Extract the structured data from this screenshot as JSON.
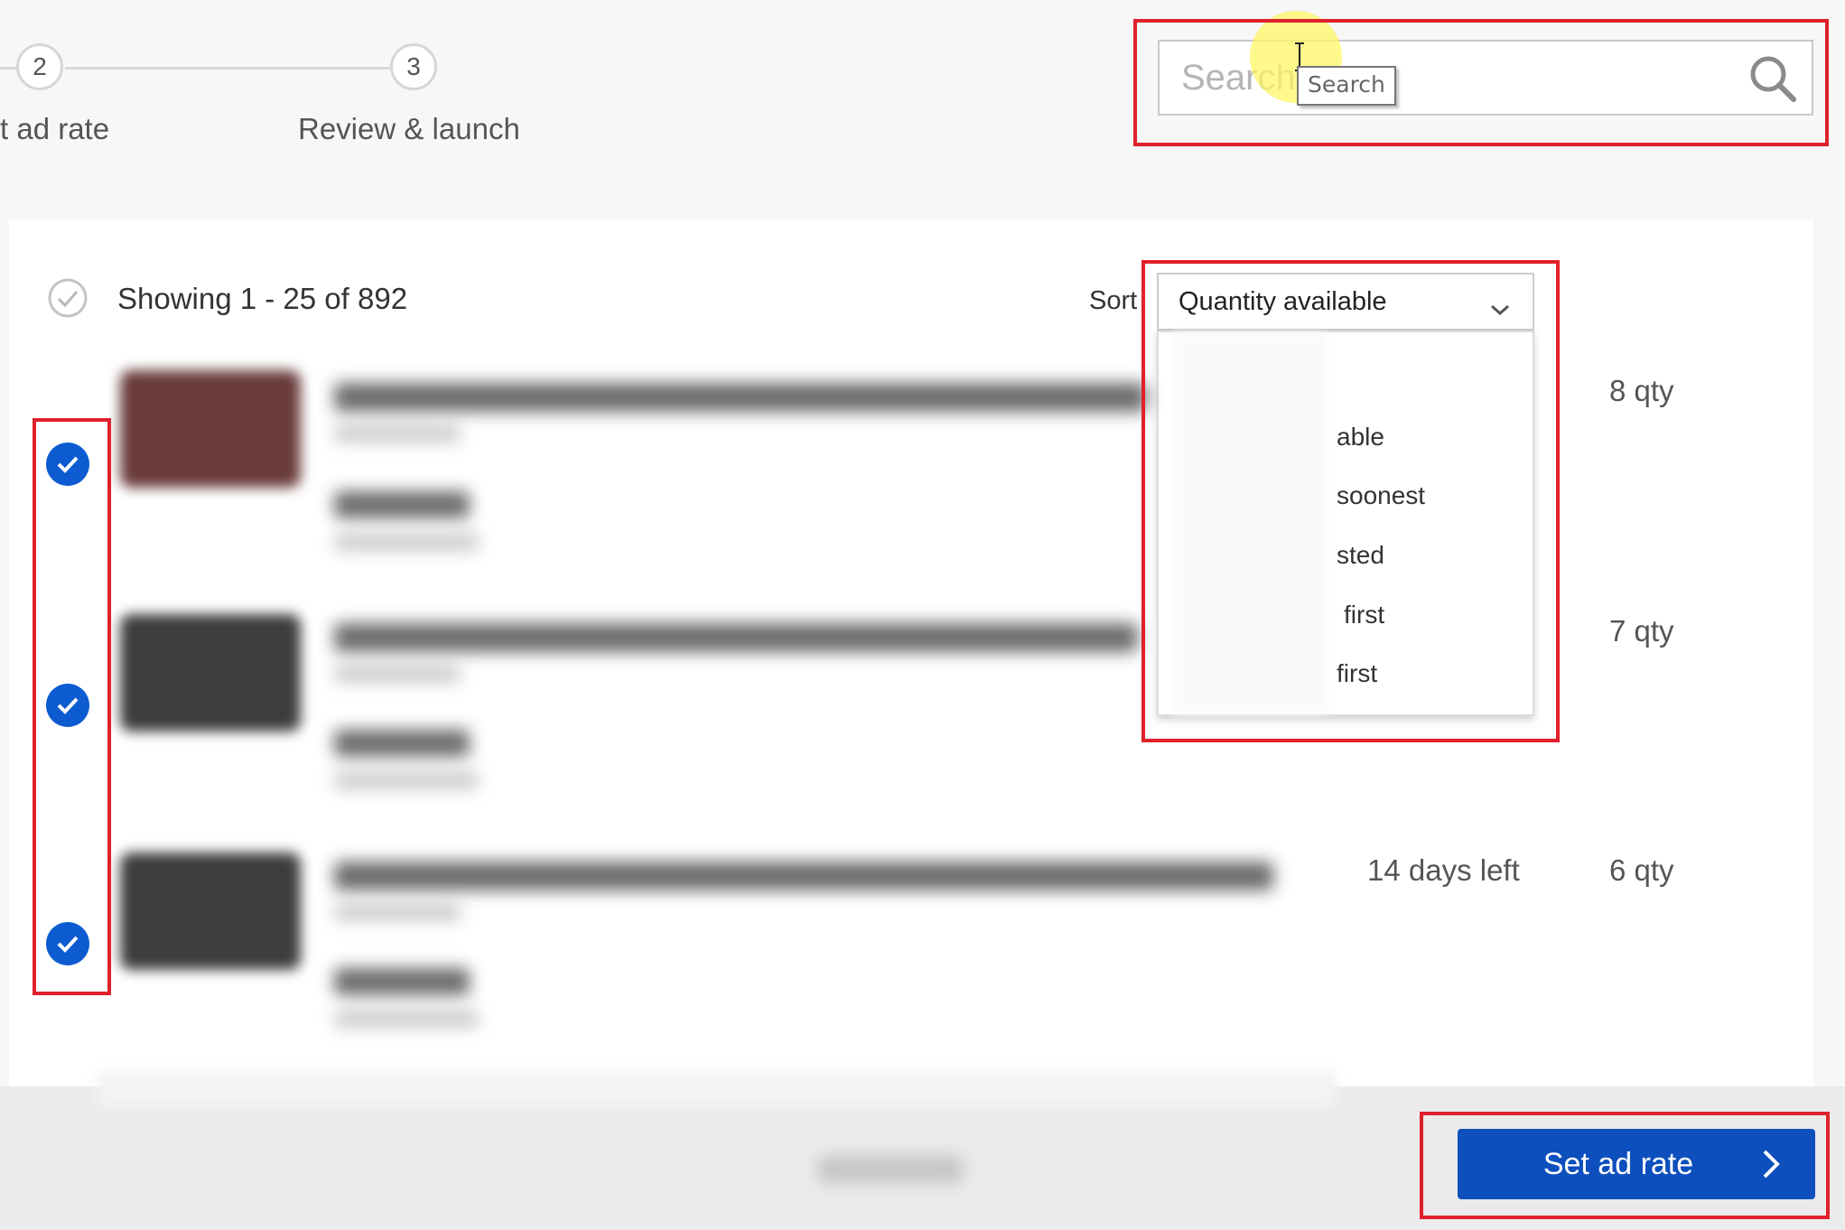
{
  "stepper": {
    "steps": [
      {
        "number": "2",
        "label": "t ad rate"
      },
      {
        "number": "3",
        "label": "Review & launch"
      }
    ]
  },
  "search": {
    "placeholder": "Search...",
    "tooltip": "Search",
    "icon": "search-icon"
  },
  "results": {
    "showing": "Showing 1 - 25 of 892",
    "sort_label": "Sort",
    "sort_selected": "Quantity available",
    "sort_options_visible": [
      "able",
      "soonest",
      "sted",
      "first",
      "first"
    ]
  },
  "listings": [
    {
      "checked": true,
      "time_left": "",
      "quantity": "8 qty"
    },
    {
      "checked": true,
      "time_left": "",
      "quantity": "7 qty"
    },
    {
      "checked": true,
      "time_left": "14 days left",
      "quantity": "6 qty"
    }
  ],
  "footer": {
    "primary_button": "Set ad rate"
  },
  "colors": {
    "accent": "#0d4fbd",
    "check": "#0d5bd1",
    "annotation": "#e0202c"
  }
}
